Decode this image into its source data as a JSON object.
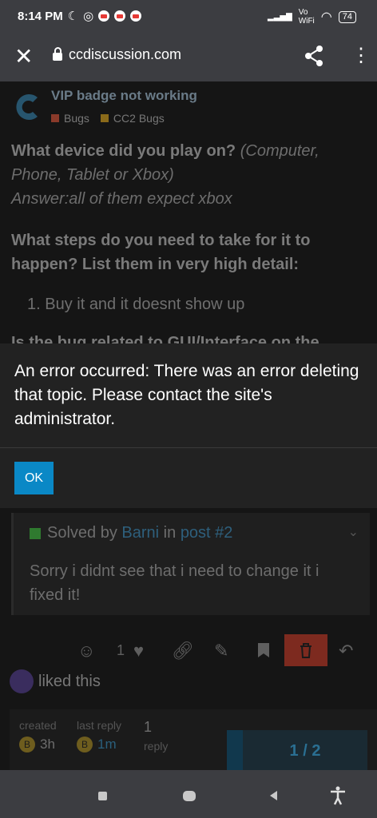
{
  "status": {
    "time": "8:14 PM",
    "vo": "Vo",
    "wifi_label": "WiFi",
    "battery": "74"
  },
  "browser": {
    "url": "ccdiscussion.com"
  },
  "topic": {
    "title": "VIP badge not working",
    "cat1": "Bugs",
    "cat2": "CC2 Bugs"
  },
  "post": {
    "q1": "What device did you play on?",
    "q1_hint": "(Computer, Phone, Tablet or Xbox)",
    "a1": "Answer:all of them expect xbox",
    "q2": "What steps do you need to take for it to happen? List them in very high detail:",
    "step1": "1. Buy it and it doesnt show up",
    "q3": "Is the bug related to GUI/Interface on the"
  },
  "solved": {
    "prefix": "Solved by",
    "user": "Barni",
    "in": "in",
    "post": "post #2",
    "text": "Sorry i didnt see that i need to change it i fixed it!"
  },
  "actions": {
    "like_count": "1"
  },
  "liked": {
    "text": "liked this"
  },
  "meta": {
    "created_label": "created",
    "created_val": "3h",
    "last_label": "last reply",
    "last_val": "1m",
    "replies_num": "1",
    "replies_label": "reply",
    "badge": "B"
  },
  "pager": {
    "text": "1 / 2"
  },
  "dialog": {
    "message": "An error occurred: There was an error deleting that topic. Please contact the site's administrator.",
    "ok": "OK"
  },
  "colors": {
    "accent": "#0a88c6",
    "bar": "#3c3d41"
  }
}
